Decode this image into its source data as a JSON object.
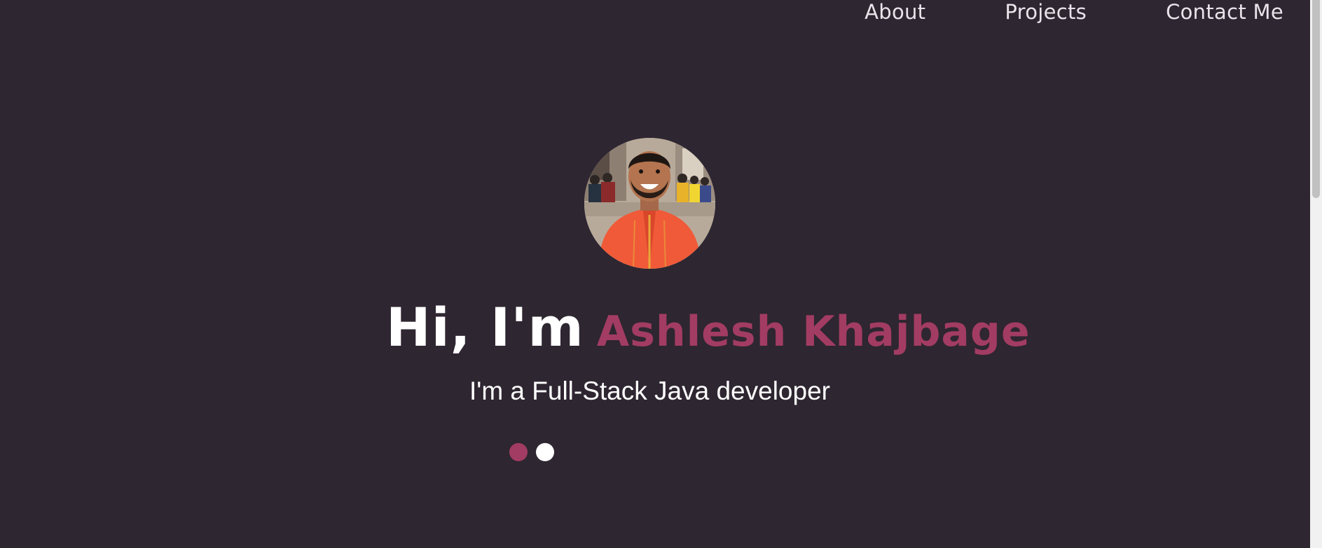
{
  "nav": {
    "items": [
      {
        "label": "About"
      },
      {
        "label": "Projects"
      },
      {
        "label": "Contact Me"
      }
    ]
  },
  "hero": {
    "avatar_alt": "profile photo",
    "greeting": "Hi, I'm",
    "name": "Ashlesh Khajbage",
    "tagline": "I'm a Full-Stack Java developer"
  },
  "carousel": {
    "dots": [
      {
        "state": "active",
        "color": "#a23c62"
      },
      {
        "state": "inactive",
        "color": "#ffffff"
      }
    ]
  },
  "colors": {
    "background": "#2e2631",
    "accent": "#a23c62",
    "text": "#ffffff"
  }
}
